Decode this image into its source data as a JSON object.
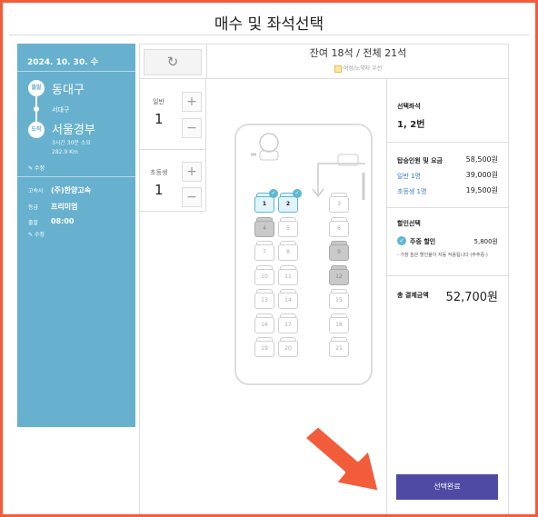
{
  "title": "매수 및 좌석선택",
  "route": {
    "date": "2024. 10. 30. 수",
    "depart_badge": "출발",
    "depart": "동대구",
    "via": "서대구",
    "arrive_badge": "도착",
    "arrive": "서울경부",
    "duration": "3시간 30분 소요",
    "distance": "282.9 Km",
    "edit1": "수정",
    "company_label": "고속사",
    "company": "(주)한양고속",
    "grade_label": "등급",
    "grade": "프리미엄",
    "time_label": "출발",
    "time": "08:00",
    "edit2": "수정"
  },
  "seat_status": "잔여 18석 / 전체 21석",
  "legend": "여성/노약자 우선",
  "passengers": [
    {
      "label": "일반",
      "count": "1"
    },
    {
      "label": "초등생",
      "count": "1"
    }
  ],
  "buttons": {
    "plus": "+",
    "minus": "−",
    "refresh": "↻"
  },
  "seats": [
    {
      "n": "1",
      "s": "sel"
    },
    {
      "n": "2",
      "s": "sel"
    },
    {
      "n": "3",
      "s": "free"
    },
    {
      "n": "4",
      "s": "taken"
    },
    {
      "n": "5",
      "s": "free"
    },
    {
      "n": "6",
      "s": "free"
    },
    {
      "n": "7",
      "s": "free"
    },
    {
      "n": "8",
      "s": "free"
    },
    {
      "n": "9",
      "s": "taken"
    },
    {
      "n": "10",
      "s": "free"
    },
    {
      "n": "11",
      "s": "free"
    },
    {
      "n": "12",
      "s": "taken"
    },
    {
      "n": "13",
      "s": "free"
    },
    {
      "n": "14",
      "s": "free"
    },
    {
      "n": "15",
      "s": "free"
    },
    {
      "n": "16",
      "s": "free"
    },
    {
      "n": "17",
      "s": "free"
    },
    {
      "n": "18",
      "s": "free"
    },
    {
      "n": "19",
      "s": "free"
    },
    {
      "n": "20",
      "s": "free"
    },
    {
      "n": "21",
      "s": "free"
    }
  ],
  "summary": {
    "selected_title": "선택좌석",
    "selected_value": "1, 2번",
    "fare_title": "탑승인원 및 요금",
    "fare_total": "58,500원",
    "fare_rows": [
      {
        "label": "일반 1명",
        "value": "39,000원"
      },
      {
        "label": "초등생 1명",
        "value": "19,500원"
      }
    ],
    "discount_title": "할인선택",
    "discount_name": "주중 할인",
    "discount_value": "5,800원",
    "discount_note": "- 가장 높은 할인율이 자동 적용됩니다 (주주중-)",
    "total_label": "총 결제금액",
    "total_value": "52,700원"
  },
  "confirm": "선택완료",
  "colors": {
    "frame": "#f25c3b",
    "panel": "#67b1cf",
    "accent": "#5cb8d4",
    "confirm": "#4f4ba4"
  }
}
